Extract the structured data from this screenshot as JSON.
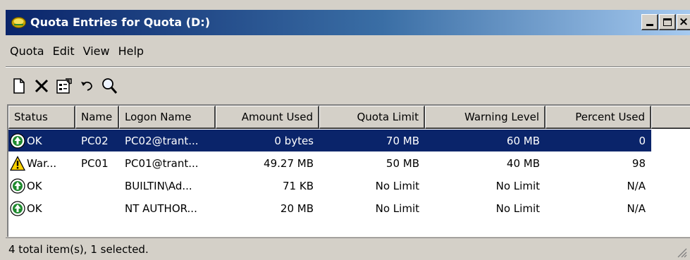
{
  "window": {
    "title": "Quota Entries for Quota (D:)",
    "icon": "drive-quota-icon"
  },
  "menu": [
    "Quota",
    "Edit",
    "View",
    "Help"
  ],
  "toolbar": [
    "new-entry-icon",
    "delete-icon",
    "properties-icon",
    "undo-icon",
    "find-icon"
  ],
  "columns": [
    {
      "label": "Status"
    },
    {
      "label": "Name"
    },
    {
      "label": "Logon Name"
    },
    {
      "label": "Amount Used"
    },
    {
      "label": "Quota Limit"
    },
    {
      "label": "Warning Level"
    },
    {
      "label": "Percent Used"
    }
  ],
  "rows": [
    {
      "status": "OK",
      "status_icon": "ok-icon",
      "name": "PC02",
      "logon": "PC02@trant...",
      "amount": "0 bytes",
      "limit": "70 MB",
      "warning": "60 MB",
      "percent": "0",
      "selected": true
    },
    {
      "status": "War...",
      "status_icon": "warning-icon",
      "name": "PC01",
      "logon": "PC01@trant...",
      "amount": "49.27 MB",
      "limit": "50 MB",
      "warning": "40 MB",
      "percent": "98",
      "selected": false
    },
    {
      "status": "OK",
      "status_icon": "ok-icon",
      "name": "",
      "logon": "BUILTIN\\Ad...",
      "amount": "71 KB",
      "limit": "No Limit",
      "warning": "No Limit",
      "percent": "N/A",
      "selected": false
    },
    {
      "status": "OK",
      "status_icon": "ok-icon",
      "name": "",
      "logon": "NT AUTHOR...",
      "amount": "20 MB",
      "limit": "No Limit",
      "warning": "No Limit",
      "percent": "N/A",
      "selected": false
    }
  ],
  "statusbar": {
    "text": "4 total item(s), 1 selected."
  },
  "colors": {
    "titlebar_start": "#0a246a",
    "titlebar_end": "#a6caf0",
    "selection": "#0a246a",
    "ok": "#1f8a2e",
    "warning": "#ffd200"
  }
}
